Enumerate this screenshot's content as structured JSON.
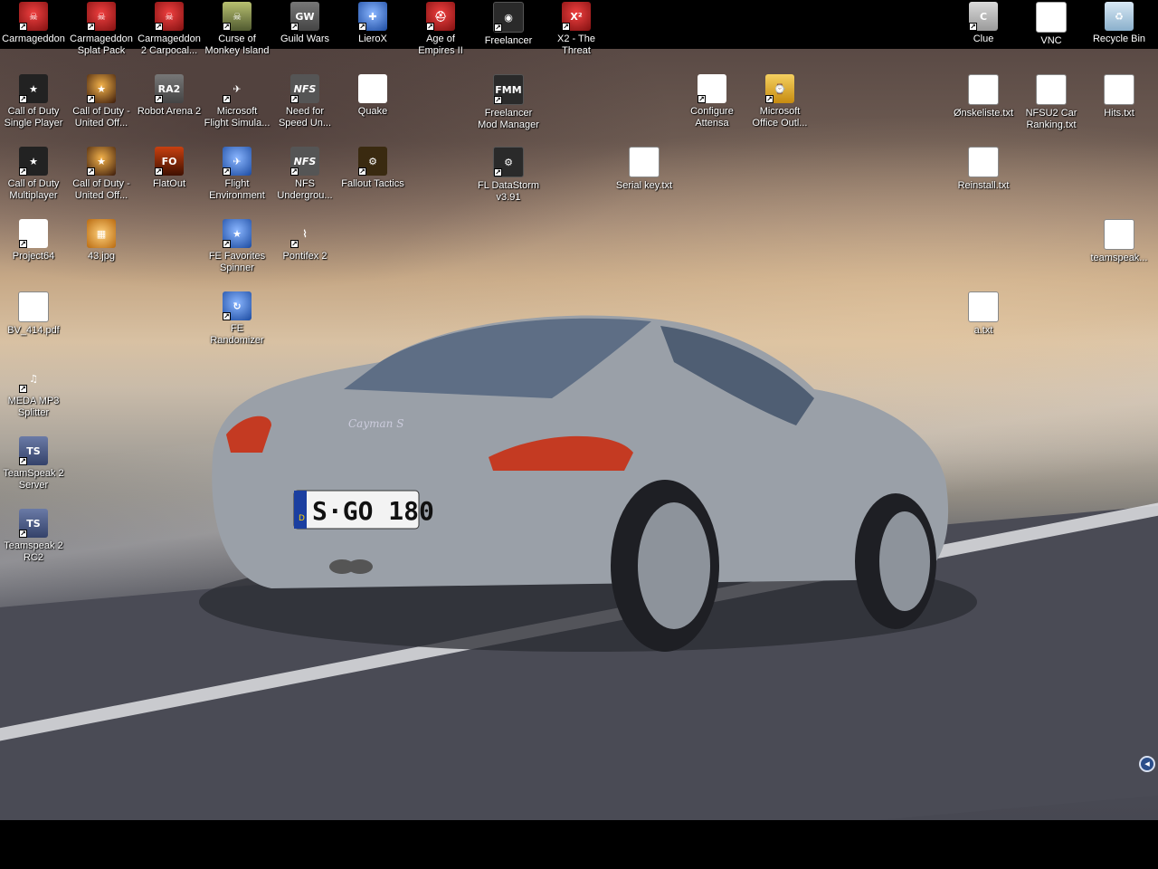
{
  "desktop": {
    "top_row": [
      {
        "id": "carmageddon",
        "label": "Carmageddon",
        "glyph": "☠",
        "style": "g-red",
        "shortcut": true
      },
      {
        "id": "carmageddon-splat",
        "label": "Carmageddon Splat Pack",
        "glyph": "☠",
        "style": "g-red",
        "shortcut": true
      },
      {
        "id": "carmageddon2",
        "label": "Carmageddon 2 Carpocal...",
        "glyph": "☠",
        "style": "g-red",
        "shortcut": true
      },
      {
        "id": "monkey-island",
        "label": "Curse of Monkey Island",
        "glyph": "☠",
        "style": "g-skull",
        "shortcut": true
      },
      {
        "id": "guild-wars",
        "label": "Guild Wars",
        "glyph": "GW",
        "style": "g-gray",
        "shortcut": true
      },
      {
        "id": "lierox",
        "label": "LieroX",
        "glyph": "✚",
        "style": "g-blue",
        "shortcut": true
      },
      {
        "id": "aoe2",
        "label": "Age of Empires II",
        "glyph": "⛑",
        "style": "g-red",
        "shortcut": true
      },
      {
        "id": "freelancer",
        "label": "Freelancer",
        "glyph": "◉",
        "style": "g-dark",
        "shortcut": true
      },
      {
        "id": "x2",
        "label": "X2 - The Threat",
        "glyph": "X²",
        "style": "g-red",
        "shortcut": true
      },
      {
        "id": "clue",
        "label": "Clue",
        "glyph": "C",
        "style": "g-clue",
        "shortcut": true
      },
      {
        "id": "vnc",
        "label": "VNC",
        "glyph": "Vnc",
        "style": "g-vnc",
        "shortcut": false
      },
      {
        "id": "recycle-bin",
        "label": "Recycle Bin",
        "glyph": "♻",
        "style": "g-bin",
        "shortcut": false
      }
    ],
    "icons": [
      {
        "id": "cod-sp",
        "label": "Call of Duty Single Player",
        "glyph": "★",
        "style": "g-star",
        "shortcut": true
      },
      {
        "id": "cod-uo",
        "label": "Call of Duty - United Off...",
        "glyph": "★",
        "style": "g-cod",
        "shortcut": true
      },
      {
        "id": "ra2",
        "label": "Robot Arena 2",
        "glyph": "RA2",
        "style": "g-gray",
        "shortcut": true
      },
      {
        "id": "msfs",
        "label": "Microsoft Flight Simula...",
        "glyph": "✈",
        "style": "g-air",
        "shortcut": true
      },
      {
        "id": "nfs-un",
        "label": "Need for Speed Un...",
        "glyph": "NFS",
        "style": "g-nfs",
        "shortcut": true
      },
      {
        "id": "quake",
        "label": "Quake",
        "glyph": "Q",
        "style": "g-quake",
        "shortcut": false
      },
      {
        "id": "fl-modman",
        "label": "Freelancer Mod Manager",
        "glyph": "FMM",
        "style": "g-dark",
        "shortcut": true
      },
      {
        "id": "attensa",
        "label": "Configure Attensa",
        "glyph": "a",
        "style": "g-attensa",
        "shortcut": true
      },
      {
        "id": "outlook",
        "label": "Microsoft Office Outl...",
        "glyph": "⌚",
        "style": "g-outlook",
        "shortcut": true
      },
      {
        "id": "onskeliste",
        "label": "Ønskeliste.txt",
        "glyph": "≡",
        "style": "g-doc",
        "shortcut": false
      },
      {
        "id": "nfsu2-ranking",
        "label": "NFSU2 Car Ranking.txt",
        "glyph": "≡",
        "style": "g-doc",
        "shortcut": false
      },
      {
        "id": "hits",
        "label": "Hits.txt",
        "glyph": "≡",
        "style": "g-doc",
        "shortcut": false
      },
      {
        "id": "cod-mp",
        "label": "Call of Duty Multiplayer",
        "glyph": "★",
        "style": "g-star",
        "shortcut": true
      },
      {
        "id": "cod-uo2",
        "label": "Call of Duty - United Off...",
        "glyph": "★",
        "style": "g-cod",
        "shortcut": true
      },
      {
        "id": "flatout",
        "label": "FlatOut",
        "glyph": "FO",
        "style": "g-flat",
        "shortcut": true
      },
      {
        "id": "flight-env",
        "label": "Flight Environment",
        "glyph": "✈",
        "style": "g-blue",
        "shortcut": true
      },
      {
        "id": "nfs-ug",
        "label": "NFS Undergrou...",
        "glyph": "NFS",
        "style": "g-nfs",
        "shortcut": true
      },
      {
        "id": "fallout-tactics",
        "label": "Fallout Tactics",
        "glyph": "⚙",
        "style": "g-fallout",
        "shortcut": true
      },
      {
        "id": "fl-datastorm",
        "label": "FL DataStorm v3.91",
        "glyph": "⚙",
        "style": "g-dark",
        "shortcut": true
      },
      {
        "id": "serial-key",
        "label": "Serial key.txt",
        "glyph": "≡",
        "style": "g-doc",
        "shortcut": false
      },
      {
        "id": "reinstall",
        "label": "Reinstall.txt",
        "glyph": "≡",
        "style": "g-doc",
        "shortcut": false
      },
      {
        "id": "project64",
        "label": "Project64",
        "glyph": "PJ",
        "style": "g-white",
        "shortcut": true
      },
      {
        "id": "jpg43",
        "label": "43.jpg",
        "glyph": "▦",
        "style": "g-orange",
        "shortcut": false
      },
      {
        "id": "fe-spinner",
        "label": "FE Favorites Spinner",
        "glyph": "★",
        "style": "g-blue",
        "shortcut": true
      },
      {
        "id": "pontifex2",
        "label": "Pontifex 2",
        "glyph": "⌇",
        "style": "g-air",
        "shortcut": true
      },
      {
        "id": "teamspeak-txt",
        "label": "teamspeak...",
        "glyph": "≡",
        "style": "g-doc",
        "shortcut": false
      },
      {
        "id": "bv414",
        "label": "BV_414.pdf",
        "glyph": "PDF",
        "style": "g-pdf",
        "shortcut": false
      },
      {
        "id": "fe-randomizer",
        "label": "FE Randomizer",
        "glyph": "↻",
        "style": "g-blue",
        "shortcut": true
      },
      {
        "id": "a-txt",
        "label": "a.txt",
        "glyph": "≡",
        "style": "g-doc",
        "shortcut": false
      },
      {
        "id": "meda-mp3",
        "label": "MEDA MP3 Splitter",
        "glyph": "♫",
        "style": "g-mp3",
        "shortcut": true
      },
      {
        "id": "ts2-server",
        "label": "TeamSpeak 2 Server",
        "glyph": "TS",
        "style": "g-ts",
        "shortcut": true
      },
      {
        "id": "ts2-rc2",
        "label": "Teamspeak 2 RC2",
        "glyph": "TS",
        "style": "g-ts",
        "shortcut": true
      }
    ],
    "wallpaper": {
      "plate": "S·GO 180",
      "model_script": "Cayman S",
      "plate_country": "D"
    },
    "tray": {
      "glyph": "◂"
    }
  }
}
